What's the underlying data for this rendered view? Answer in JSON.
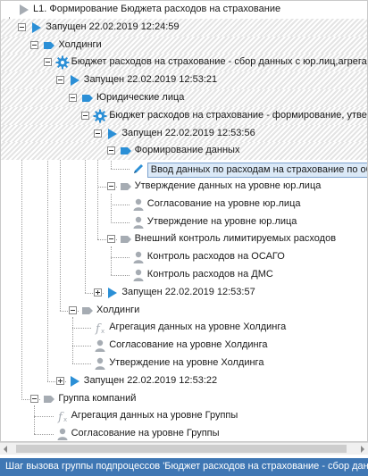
{
  "tree": {
    "rows": [
      {
        "depth": 0,
        "toggle": "none",
        "icon": "play-gray-icon",
        "label": "L1. Формирование Бюджета расходов на страхование",
        "bold": false,
        "hatched": false,
        "selected": false
      },
      {
        "depth": 1,
        "toggle": "minus",
        "icon": "play-blue-icon",
        "label": "Запущен 22.02.2019 12:24:59",
        "bold": false,
        "hatched": true,
        "selected": false
      },
      {
        "depth": 2,
        "toggle": "minus",
        "icon": "tag-blue-icon",
        "label": "Холдинги",
        "bold": false,
        "hatched": true,
        "selected": false
      },
      {
        "depth": 3,
        "toggle": "minus",
        "icon": "gear-blue-icon",
        "label": "Бюджет расходов на страхование - сбор данных с юр.лиц,агрегация",
        "bold": false,
        "hatched": true,
        "selected": false
      },
      {
        "depth": 4,
        "toggle": "minus",
        "icon": "play-blue-icon",
        "label": "Запущен 22.02.2019 12:53:21",
        "bold": false,
        "hatched": true,
        "selected": false
      },
      {
        "depth": 5,
        "toggle": "minus",
        "icon": "tag-blue-icon",
        "label": "Юридические лица",
        "bold": false,
        "hatched": true,
        "selected": false
      },
      {
        "depth": 6,
        "toggle": "minus",
        "icon": "gear-blue-icon",
        "label": "Бюджет расходов на страхование - формирование, утверждение",
        "bold": false,
        "hatched": true,
        "selected": false
      },
      {
        "depth": 7,
        "toggle": "minus",
        "icon": "play-blue-icon",
        "label": "Запущен 22.02.2019 12:53:56",
        "bold": false,
        "hatched": true,
        "selected": false
      },
      {
        "depth": 8,
        "toggle": "minus",
        "icon": "tag-blue-icon",
        "label": "Формирование данных",
        "bold": false,
        "hatched": true,
        "selected": false
      },
      {
        "depth": 9,
        "toggle": "none",
        "icon": "pencil-blue-icon",
        "label": "Ввод данных по расходам на страхование по объектам",
        "bold": false,
        "hatched": false,
        "selected": true
      },
      {
        "depth": 8,
        "toggle": "minus",
        "icon": "tag-gray-icon",
        "label": "Утверждение данных на уровне юр.лица",
        "bold": false,
        "hatched": false,
        "selected": false
      },
      {
        "depth": 9,
        "toggle": "none",
        "icon": "user-gray-icon",
        "label": "Согласование на уровне юр.лица",
        "bold": false,
        "hatched": false,
        "selected": false
      },
      {
        "depth": 9,
        "toggle": "none",
        "icon": "user-gray-icon",
        "label": "Утверждение на уровне юр.лица",
        "bold": false,
        "hatched": false,
        "selected": false
      },
      {
        "depth": 8,
        "toggle": "minus",
        "icon": "tag-gray-icon",
        "label": "Внешний контроль лимитируемых расходов",
        "bold": false,
        "hatched": false,
        "selected": false
      },
      {
        "depth": 9,
        "toggle": "none",
        "icon": "user-gray-icon",
        "label": "Контроль расходов на ОСАГО",
        "bold": false,
        "hatched": false,
        "selected": false
      },
      {
        "depth": 9,
        "toggle": "none",
        "icon": "user-gray-icon",
        "label": "Контроль расходов на ДМС",
        "bold": false,
        "hatched": false,
        "selected": false
      },
      {
        "depth": 7,
        "toggle": "plus",
        "icon": "play-blue-icon",
        "label": "Запущен 22.02.2019 12:53:57",
        "bold": false,
        "hatched": false,
        "selected": false
      },
      {
        "depth": 5,
        "toggle": "minus",
        "icon": "tag-gray-icon",
        "label": "Холдинги",
        "bold": false,
        "hatched": false,
        "selected": false
      },
      {
        "depth": 6,
        "toggle": "none",
        "icon": "function-gray-icon",
        "label": "Агрегация данных на уровне Холдинга",
        "bold": false,
        "hatched": false,
        "selected": false
      },
      {
        "depth": 6,
        "toggle": "none",
        "icon": "user-gray-icon",
        "label": "Согласование на уровне Холдинга",
        "bold": false,
        "hatched": false,
        "selected": false
      },
      {
        "depth": 6,
        "toggle": "none",
        "icon": "user-gray-icon",
        "label": "Утверждение на уровне Холдинга",
        "bold": false,
        "hatched": false,
        "selected": false
      },
      {
        "depth": 4,
        "toggle": "plus",
        "icon": "play-blue-icon",
        "label": "Запущен 22.02.2019 12:53:22",
        "bold": false,
        "hatched": false,
        "selected": false
      },
      {
        "depth": 2,
        "toggle": "minus",
        "icon": "tag-gray-icon",
        "label": "Группа компаний",
        "bold": false,
        "hatched": false,
        "selected": false
      },
      {
        "depth": 3,
        "toggle": "none",
        "icon": "function-gray-icon",
        "label": "Агрегация данных на уровне Группы",
        "bold": false,
        "hatched": false,
        "selected": false
      },
      {
        "depth": 3,
        "toggle": "none",
        "icon": "user-gray-icon",
        "label": "Согласование на уровне Группы",
        "bold": false,
        "hatched": false,
        "selected": false
      }
    ]
  },
  "status_bar": {
    "text": "Шаг вызова группы подпроцессов 'Бюджет расходов на страхование - сбор данных с юр.лиц,агрегация'"
  },
  "colors": {
    "accent_blue": "#2b8fd6",
    "icon_gray": "#a6acb3",
    "selection_fill": "#dbe9f7",
    "status_bar": "#3f77b4"
  }
}
